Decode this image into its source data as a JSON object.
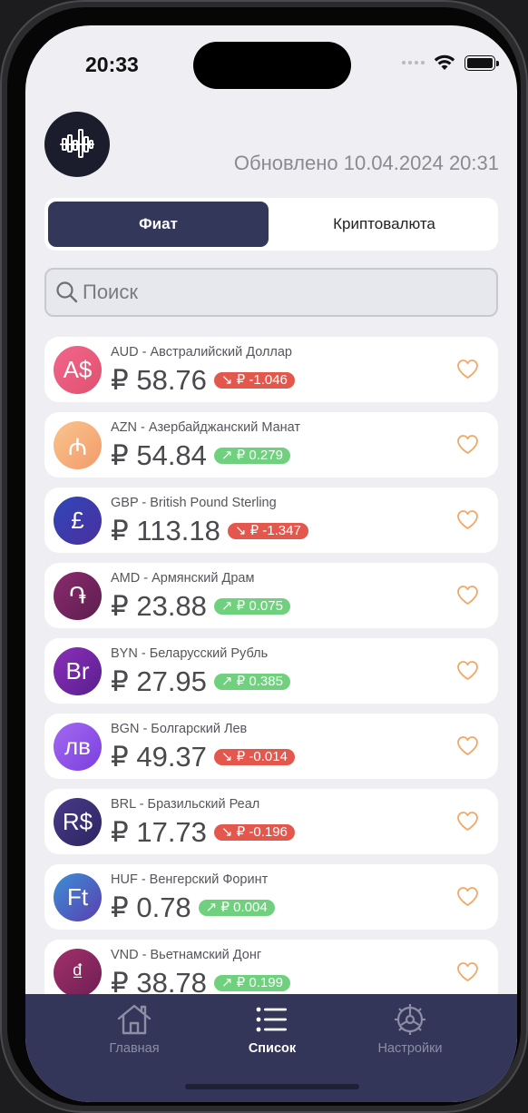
{
  "status": {
    "time": "20:33"
  },
  "header": {
    "updated": "Обновлено 10.04.2024 20:31"
  },
  "segment": {
    "fiat": "Фиат",
    "crypto": "Криптовалюта"
  },
  "search": {
    "placeholder": "Поиск"
  },
  "currencies": [
    {
      "code": "AUD",
      "name": "AUD - Австралийский Доллар",
      "symbol": "A$",
      "rate": "₽ 58.76",
      "change": "↘ ₽ -1.046",
      "trend": "down",
      "color_from": "#f2668b",
      "color_to": "#e0516f"
    },
    {
      "code": "AZN",
      "name": "AZN - Азербайджанский Манат",
      "symbol": "₼",
      "rate": "₽ 54.84",
      "change": "↗ ₽ 0.279",
      "trend": "up",
      "color_from": "#f9c58d",
      "color_to": "#f39a6a"
    },
    {
      "code": "GBP",
      "name": "GBP - British Pound Sterling",
      "symbol": "£",
      "rate": "₽ 113.18",
      "change": "↘ ₽ -1.347",
      "trend": "down",
      "color_from": "#2f47b8",
      "color_to": "#4b2f9e"
    },
    {
      "code": "AMD",
      "name": "AMD - Армянский Драм",
      "symbol": "֏",
      "rate": "₽ 23.88",
      "change": "↗ ₽ 0.075",
      "trend": "up",
      "color_from": "#8b2a6e",
      "color_to": "#5c1f4f"
    },
    {
      "code": "BYN",
      "name": "BYN - Беларусский Рубль",
      "symbol": "Br",
      "rate": "₽ 27.95",
      "change": "↗ ₽ 0.385",
      "trend": "up",
      "color_from": "#8a2fb8",
      "color_to": "#5a1f8e"
    },
    {
      "code": "BGN",
      "name": "BGN - Болгарский Лев",
      "symbol": "лв",
      "rate": "₽ 49.37",
      "change": "↘ ₽ -0.014",
      "trend": "down",
      "color_from": "#a36af0",
      "color_to": "#7b3fe0"
    },
    {
      "code": "BRL",
      "name": "BRL - Бразильский Реал",
      "symbol": "R$",
      "rate": "₽ 17.73",
      "change": "↘ ₽ -0.196",
      "trend": "down",
      "color_from": "#4a3a8a",
      "color_to": "#2b2560"
    },
    {
      "code": "HUF",
      "name": "HUF - Венгерский Форинт",
      "symbol": "Ft",
      "rate": "₽ 0.78",
      "change": "↗ ₽ 0.004",
      "trend": "up",
      "color_from": "#3c8fd6",
      "color_to": "#5a3fb0"
    },
    {
      "code": "VND",
      "name": "VND - Вьетнамский Донг",
      "symbol": "₫",
      "rate": "₽ 38.78",
      "change": "↗ ₽ 0.199",
      "trend": "up",
      "color_from": "#a3306a",
      "color_to": "#6e1f55"
    }
  ],
  "tabs": {
    "home": "Главная",
    "list": "Список",
    "settings": "Настройки"
  },
  "colors": {
    "accent": "#33375a",
    "down": "#e4574c",
    "up": "#6fd17e",
    "heart": "#f1a865",
    "tabbar": "#343659"
  },
  "icons": {
    "logo": "chart-bars-icon",
    "heart": "heart-outline-icon",
    "home": "house-icon",
    "list": "list-icon",
    "settings": "gear-icon"
  }
}
